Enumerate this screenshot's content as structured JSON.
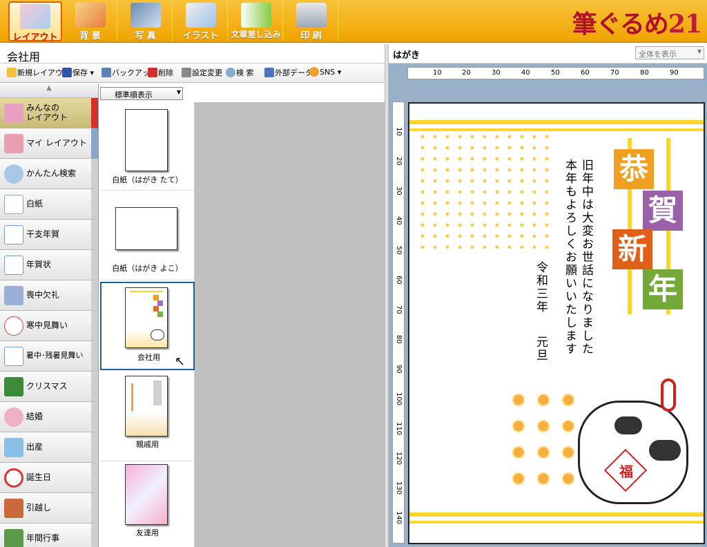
{
  "toolbar": {
    "buttons": [
      {
        "label": "レイアウト",
        "icon": "layout-icon",
        "active": true
      },
      {
        "label": "背 景",
        "icon": "background-icon",
        "active": false
      },
      {
        "label": "写 真",
        "icon": "photo-icon",
        "active": false
      },
      {
        "label": "イラスト",
        "icon": "illustration-icon",
        "active": false
      },
      {
        "label": "文章差し込み",
        "icon": "text-insert-icon",
        "active": false
      },
      {
        "label": "印 刷",
        "icon": "print-icon",
        "active": false
      }
    ],
    "logo": "筆ぐるめ",
    "logo_num": "21"
  },
  "left": {
    "title": "会社用",
    "tools": [
      "新規レイアウト",
      "保存",
      "バックアップ",
      "削除",
      "設定変更",
      "検 索",
      "外部データ",
      "SNS"
    ],
    "sort_label": "標準順表示"
  },
  "categories": [
    {
      "label": "みんなの\nレイアウト",
      "icon": "people-layout-icon"
    },
    {
      "label": "マイ レイアウト",
      "icon": "my-layout-icon"
    },
    {
      "label": "かんたん検索",
      "icon": "magnifier-icon"
    },
    {
      "label": "白紙",
      "icon": "blank-page-icon"
    },
    {
      "label": "干支年賀",
      "icon": "zodiac-card-icon"
    },
    {
      "label": "年賀状",
      "icon": "new-year-card-icon"
    },
    {
      "label": "喪中欠礼",
      "icon": "mourning-card-icon"
    },
    {
      "label": "寒中見舞い",
      "icon": "snowman-icon"
    },
    {
      "label": "暑中･残暑見舞い",
      "icon": "summer-card-icon"
    },
    {
      "label": "クリスマス",
      "icon": "christmas-tree-icon"
    },
    {
      "label": "結婚",
      "icon": "wedding-icon"
    },
    {
      "label": "出産",
      "icon": "baby-icon"
    },
    {
      "label": "誕生日",
      "icon": "birthday-icon"
    },
    {
      "label": "引越し",
      "icon": "house-icon"
    },
    {
      "label": "年間行事",
      "icon": "annual-event-icon"
    }
  ],
  "thumbs": [
    {
      "label": "白紙（はがき たて）"
    },
    {
      "label": "白紙（はがき よこ）"
    },
    {
      "label": "会社用"
    },
    {
      "label": "親戚用"
    },
    {
      "label": "友達用"
    }
  ],
  "right": {
    "title": "はがき",
    "view_select": "全体を表示",
    "ruler_h": [
      "10",
      "20",
      "30",
      "40",
      "50",
      "60",
      "70",
      "80",
      "90"
    ],
    "ruler_v": [
      "10",
      "20",
      "30",
      "40",
      "50",
      "60",
      "70",
      "80",
      "90",
      "100",
      "110",
      "120",
      "130",
      "140"
    ],
    "card": {
      "tiles": [
        "恭",
        "賀",
        "新",
        "年"
      ],
      "line1": "旧年中は大変お世話になりました",
      "line2": "本年もよろしくお願いいたします",
      "date1": "令和三年",
      "date2": "元旦",
      "charm": "福"
    }
  },
  "colors": {
    "toolbar": "#f0a400",
    "accent_red": "#d43030",
    "selection_blue": "#1a5fa0",
    "canvas_bg": "#98b0c8",
    "stripe_yellow": "#ffd52a"
  }
}
